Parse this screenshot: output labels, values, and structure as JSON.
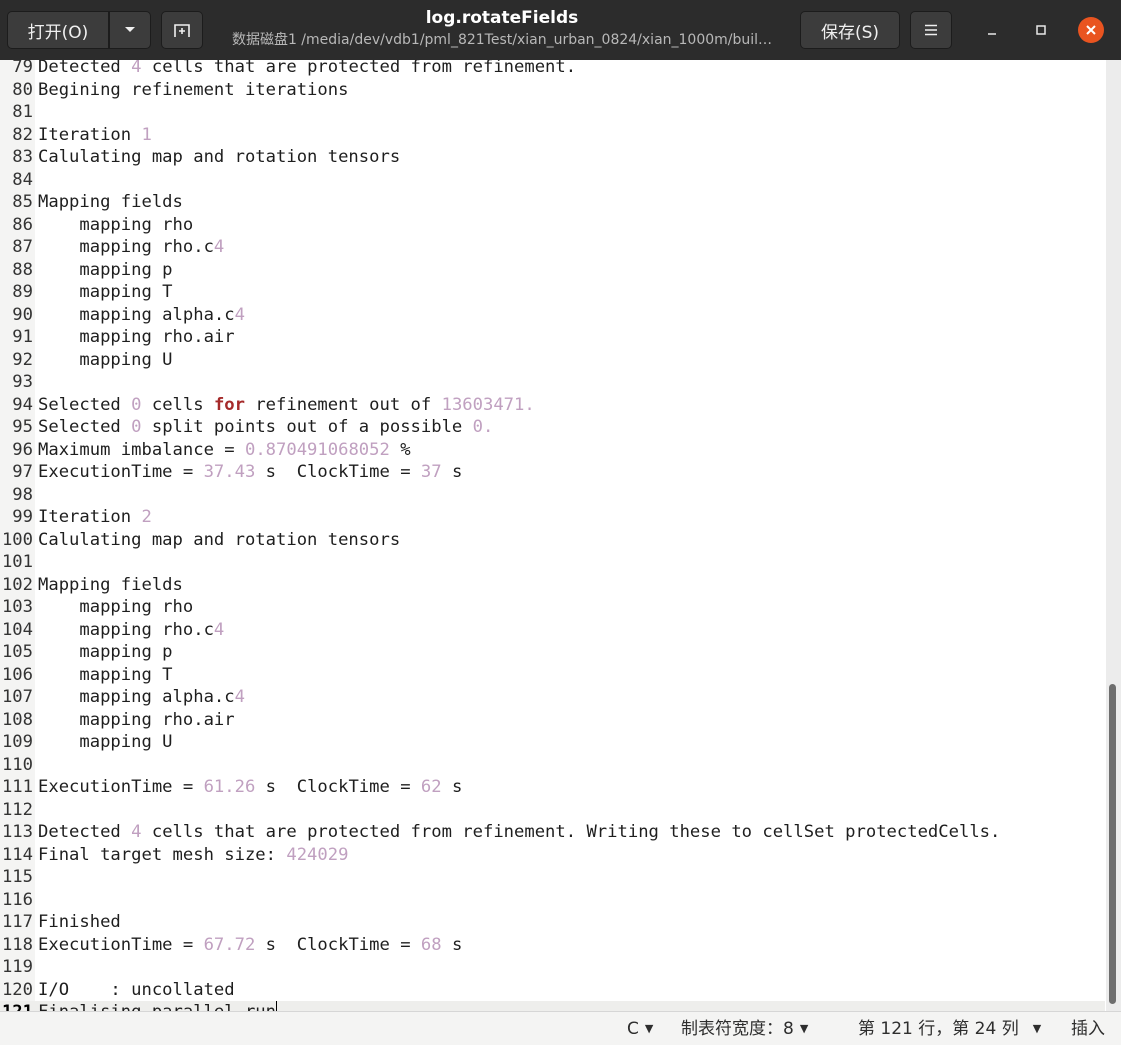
{
  "header": {
    "open_label": "打开(O)",
    "title": "log.rotateFields",
    "subtitle": "数据磁盘1 /media/dev/vdb1/pml_821Test/xian_urban_0824/xian_1000m/buil…",
    "save_label": "保存(S)"
  },
  "icons": {
    "open_menu": "chevron-down-icon",
    "new_document": "new-tab-icon",
    "hamburger": "menu-icon",
    "minimize": "minimize-icon",
    "maximize": "maximize-icon",
    "close": "close-icon"
  },
  "colors": {
    "headerbar": "#2c2c2c",
    "close_button": "#e95420",
    "number_literal": "#c0a0c0",
    "keyword": "#a52a2a"
  },
  "editor": {
    "current_line": "121",
    "lines": [
      {
        "n": "79",
        "t": "Detected 4 cells that are protected from refinement."
      },
      {
        "n": "80",
        "t": "Begining refinement iterations"
      },
      {
        "n": "81",
        "t": ""
      },
      {
        "n": "82",
        "t": "Iteration 1"
      },
      {
        "n": "83",
        "t": "Calulating map and rotation tensors"
      },
      {
        "n": "84",
        "t": ""
      },
      {
        "n": "85",
        "t": "Mapping fields"
      },
      {
        "n": "86",
        "t": "    mapping rho"
      },
      {
        "n": "87",
        "t": "    mapping rho.c4"
      },
      {
        "n": "88",
        "t": "    mapping p"
      },
      {
        "n": "89",
        "t": "    mapping T"
      },
      {
        "n": "90",
        "t": "    mapping alpha.c4"
      },
      {
        "n": "91",
        "t": "    mapping rho.air"
      },
      {
        "n": "92",
        "t": "    mapping U"
      },
      {
        "n": "93",
        "t": ""
      },
      {
        "n": "94",
        "t": "Selected 0 cells for refinement out of 13603471."
      },
      {
        "n": "95",
        "t": "Selected 0 split points out of a possible 0."
      },
      {
        "n": "96",
        "t": "Maximum imbalance = 0.870491068052 %"
      },
      {
        "n": "97",
        "t": "ExecutionTime = 37.43 s  ClockTime = 37 s"
      },
      {
        "n": "98",
        "t": ""
      },
      {
        "n": "99",
        "t": "Iteration 2"
      },
      {
        "n": "100",
        "t": "Calulating map and rotation tensors"
      },
      {
        "n": "101",
        "t": ""
      },
      {
        "n": "102",
        "t": "Mapping fields"
      },
      {
        "n": "103",
        "t": "    mapping rho"
      },
      {
        "n": "104",
        "t": "    mapping rho.c4"
      },
      {
        "n": "105",
        "t": "    mapping p"
      },
      {
        "n": "106",
        "t": "    mapping T"
      },
      {
        "n": "107",
        "t": "    mapping alpha.c4"
      },
      {
        "n": "108",
        "t": "    mapping rho.air"
      },
      {
        "n": "109",
        "t": "    mapping U"
      },
      {
        "n": "110",
        "t": ""
      },
      {
        "n": "111",
        "t": "ExecutionTime = 61.26 s  ClockTime = 62 s"
      },
      {
        "n": "112",
        "t": ""
      },
      {
        "n": "113",
        "t": "Detected 4 cells that are protected from refinement. Writing these to cellSet protectedCells."
      },
      {
        "n": "114",
        "t": "Final target mesh size: 424029"
      },
      {
        "n": "115",
        "t": ""
      },
      {
        "n": "116",
        "t": ""
      },
      {
        "n": "117",
        "t": "Finished"
      },
      {
        "n": "118",
        "t": "ExecutionTime = 67.72 s  ClockTime = 68 s"
      },
      {
        "n": "119",
        "t": ""
      },
      {
        "n": "120",
        "t": "I/O    : uncollated"
      },
      {
        "n": "121",
        "t": "Finalising parallel run"
      }
    ]
  },
  "statusbar": {
    "language": "C",
    "tab_width": "制表符宽度：8",
    "position": "第 121 行，第 24 列",
    "mode": "插入"
  }
}
